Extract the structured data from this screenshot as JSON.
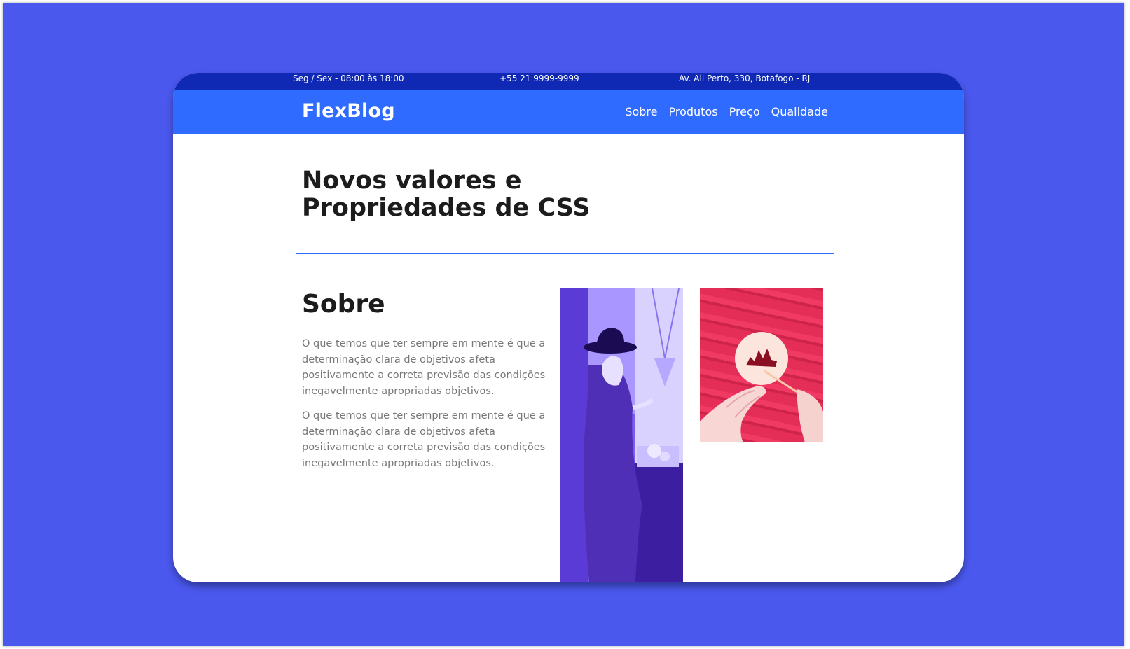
{
  "topbar": {
    "hours": "Seg / Sex - 08:00 às 18:00",
    "phone": "+55 21 9999-9999",
    "address": "Av. Ali Perto, 330, Botafogo - RJ"
  },
  "navbar": {
    "brand": "FlexBlog",
    "links": [
      "Sobre",
      "Produtos",
      "Preço",
      "Qualidade"
    ]
  },
  "hero": {
    "title_line1": "Novos valores e",
    "title_line2": "Propriedades de CSS"
  },
  "about": {
    "heading": "Sobre",
    "paragraphs": [
      "O que temos que ter sempre em mente é que a determinação clara de objetivos afeta positivamente a correta previsão das condições inegavelmente apropriadas objetivos.",
      "O que temos que ter sempre em mente é que a determinação clara de objetivos afeta positivamente a correta previsão das condições inegavelmente apropriadas objetivos."
    ]
  },
  "colors": {
    "background": "#4a58ee",
    "topbar": "#0f29b4",
    "navbar": "#2f6bfe",
    "photo_purple": "#7f5ef6",
    "photo_red": "#e52e57"
  },
  "images": {
    "photo1_icon": "woman-in-hat-photo",
    "photo2_icon": "miniature-tree-painting-photo"
  }
}
